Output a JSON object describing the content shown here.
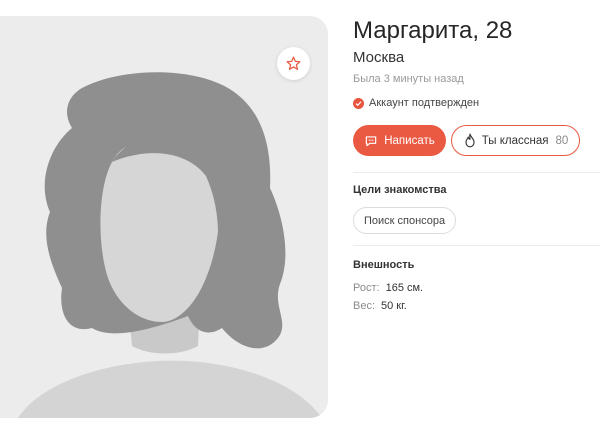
{
  "profile": {
    "name_age": "Маргарита, 28",
    "city": "Москва",
    "last_seen": "Была 3 минуты назад",
    "verified": "Аккаунт подтвержден"
  },
  "actions": {
    "write_label": "Написать",
    "like_label": "Ты классная",
    "like_count": "80"
  },
  "goals": {
    "title": "Цели знакомства",
    "items": [
      "Поиск спонсора"
    ]
  },
  "appearance": {
    "title": "Внешность",
    "height_label": "Рост:",
    "height_value": "165 см.",
    "weight_label": "Вес:",
    "weight_value": "50 кг."
  },
  "icons": {
    "favorite": "star-icon",
    "verified": "check-icon",
    "write": "chat-bubble-icon",
    "like": "flame-icon"
  },
  "colors": {
    "accent": "#ea5a43",
    "photo_bg": "#ececec",
    "hair": "#8f8f8f",
    "skin": "#d6d6d6"
  }
}
